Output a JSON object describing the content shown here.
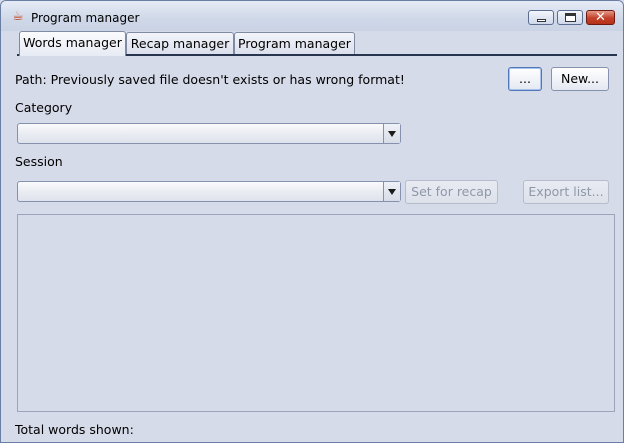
{
  "window": {
    "title": "Program manager",
    "icon": "java-cup-icon",
    "controls": {
      "minimize": "minimize-icon",
      "maximize": "maximize-icon",
      "close": "close-icon",
      "close_glyph": "✕"
    }
  },
  "tabs": [
    {
      "label": "Words manager",
      "selected": true
    },
    {
      "label": "Recap manager",
      "selected": false
    },
    {
      "label": "Program manager",
      "selected": false
    }
  ],
  "path": {
    "text": "Path: Previously saved file doesn't exists or has wrong format!",
    "browse_label": "...",
    "new_label": "New..."
  },
  "category": {
    "label": "Category",
    "value": ""
  },
  "session": {
    "label": "Session",
    "value": "",
    "set_for_recap_label": "Set for recap",
    "export_label": "Export list..."
  },
  "footer": {
    "total_words_label": "Total words shown:"
  },
  "colors": {
    "background": "#d6dbe9",
    "tab_line": "#28354f",
    "close_button": "#c3402b",
    "disabled_text": "#8f97a8"
  }
}
